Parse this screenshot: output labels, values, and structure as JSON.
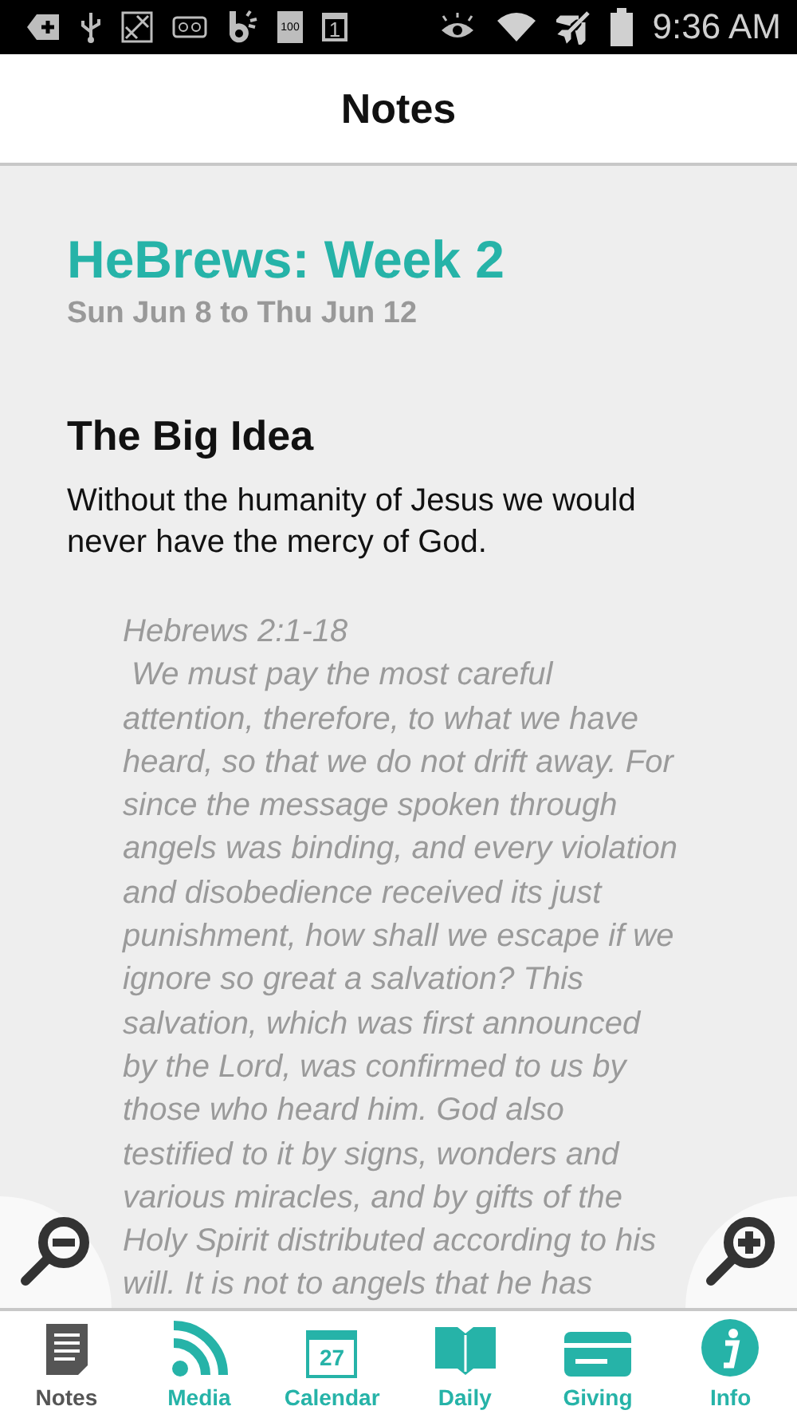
{
  "status_bar": {
    "battery_label": "100",
    "calendar_day": "1",
    "time": "9:36 AM"
  },
  "header": {
    "title": "Notes"
  },
  "content": {
    "series_title": "HeBrews: Week 2",
    "dates": "Sun Jun 8 to Thu Jun 12",
    "section_heading": "The Big Idea",
    "big_idea": "Without the humanity of Jesus we would never have the mercy of God.",
    "passage": {
      "reference": "Hebrews 2:1-18",
      "lines": [
        " We must pay the most careful",
        "attention, therefore, to what we have",
        "heard, so that we do not drift away. For",
        "since the message spoken through",
        "angels was binding, and every violation",
        "and disobedience received its just",
        "punishment, how shall we escape if we",
        "ignore so great a salvation? This",
        "salvation, which was first announced",
        "by the Lord, was confirmed to us by",
        "those who heard him. God also",
        "testified to it by signs, wonders and",
        "various miracles, and by gifts of the",
        "Holy Spirit distributed according to his",
        "will. It is not to angels that he has"
      ]
    }
  },
  "tabs": [
    {
      "kind": "notes",
      "label": "Notes",
      "selected": true
    },
    {
      "kind": "media",
      "label": "Media",
      "selected": false
    },
    {
      "kind": "calendar",
      "label": "Calendar",
      "icon_text": "27",
      "selected": false
    },
    {
      "kind": "daily",
      "label": "Daily",
      "selected": false
    },
    {
      "kind": "giving",
      "label": "Giving",
      "selected": false
    },
    {
      "kind": "info",
      "label": "Info",
      "selected": false
    }
  ]
}
